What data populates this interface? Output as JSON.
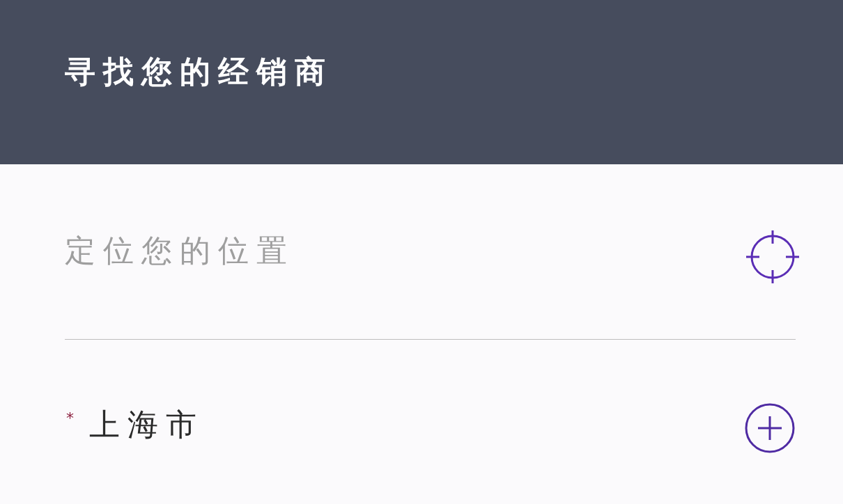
{
  "header": {
    "title": "寻找您的经销商"
  },
  "location_field": {
    "placeholder": "定位您的位置"
  },
  "city": {
    "required_mark": "*",
    "value": "上海市"
  }
}
